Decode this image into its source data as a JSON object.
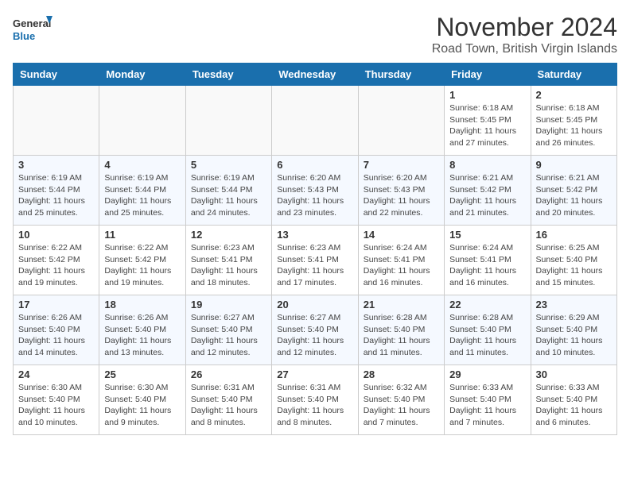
{
  "header": {
    "logo_line1": "General",
    "logo_line2": "Blue",
    "month": "November 2024",
    "location": "Road Town, British Virgin Islands"
  },
  "weekdays": [
    "Sunday",
    "Monday",
    "Tuesday",
    "Wednesday",
    "Thursday",
    "Friday",
    "Saturday"
  ],
  "weeks": [
    [
      {
        "day": "",
        "info": ""
      },
      {
        "day": "",
        "info": ""
      },
      {
        "day": "",
        "info": ""
      },
      {
        "day": "",
        "info": ""
      },
      {
        "day": "",
        "info": ""
      },
      {
        "day": "1",
        "info": "Sunrise: 6:18 AM\nSunset: 5:45 PM\nDaylight: 11 hours and 27 minutes."
      },
      {
        "day": "2",
        "info": "Sunrise: 6:18 AM\nSunset: 5:45 PM\nDaylight: 11 hours and 26 minutes."
      }
    ],
    [
      {
        "day": "3",
        "info": "Sunrise: 6:19 AM\nSunset: 5:44 PM\nDaylight: 11 hours and 25 minutes."
      },
      {
        "day": "4",
        "info": "Sunrise: 6:19 AM\nSunset: 5:44 PM\nDaylight: 11 hours and 25 minutes."
      },
      {
        "day": "5",
        "info": "Sunrise: 6:19 AM\nSunset: 5:44 PM\nDaylight: 11 hours and 24 minutes."
      },
      {
        "day": "6",
        "info": "Sunrise: 6:20 AM\nSunset: 5:43 PM\nDaylight: 11 hours and 23 minutes."
      },
      {
        "day": "7",
        "info": "Sunrise: 6:20 AM\nSunset: 5:43 PM\nDaylight: 11 hours and 22 minutes."
      },
      {
        "day": "8",
        "info": "Sunrise: 6:21 AM\nSunset: 5:42 PM\nDaylight: 11 hours and 21 minutes."
      },
      {
        "day": "9",
        "info": "Sunrise: 6:21 AM\nSunset: 5:42 PM\nDaylight: 11 hours and 20 minutes."
      }
    ],
    [
      {
        "day": "10",
        "info": "Sunrise: 6:22 AM\nSunset: 5:42 PM\nDaylight: 11 hours and 19 minutes."
      },
      {
        "day": "11",
        "info": "Sunrise: 6:22 AM\nSunset: 5:42 PM\nDaylight: 11 hours and 19 minutes."
      },
      {
        "day": "12",
        "info": "Sunrise: 6:23 AM\nSunset: 5:41 PM\nDaylight: 11 hours and 18 minutes."
      },
      {
        "day": "13",
        "info": "Sunrise: 6:23 AM\nSunset: 5:41 PM\nDaylight: 11 hours and 17 minutes."
      },
      {
        "day": "14",
        "info": "Sunrise: 6:24 AM\nSunset: 5:41 PM\nDaylight: 11 hours and 16 minutes."
      },
      {
        "day": "15",
        "info": "Sunrise: 6:24 AM\nSunset: 5:41 PM\nDaylight: 11 hours and 16 minutes."
      },
      {
        "day": "16",
        "info": "Sunrise: 6:25 AM\nSunset: 5:40 PM\nDaylight: 11 hours and 15 minutes."
      }
    ],
    [
      {
        "day": "17",
        "info": "Sunrise: 6:26 AM\nSunset: 5:40 PM\nDaylight: 11 hours and 14 minutes."
      },
      {
        "day": "18",
        "info": "Sunrise: 6:26 AM\nSunset: 5:40 PM\nDaylight: 11 hours and 13 minutes."
      },
      {
        "day": "19",
        "info": "Sunrise: 6:27 AM\nSunset: 5:40 PM\nDaylight: 11 hours and 12 minutes."
      },
      {
        "day": "20",
        "info": "Sunrise: 6:27 AM\nSunset: 5:40 PM\nDaylight: 11 hours and 12 minutes."
      },
      {
        "day": "21",
        "info": "Sunrise: 6:28 AM\nSunset: 5:40 PM\nDaylight: 11 hours and 11 minutes."
      },
      {
        "day": "22",
        "info": "Sunrise: 6:28 AM\nSunset: 5:40 PM\nDaylight: 11 hours and 11 minutes."
      },
      {
        "day": "23",
        "info": "Sunrise: 6:29 AM\nSunset: 5:40 PM\nDaylight: 11 hours and 10 minutes."
      }
    ],
    [
      {
        "day": "24",
        "info": "Sunrise: 6:30 AM\nSunset: 5:40 PM\nDaylight: 11 hours and 10 minutes."
      },
      {
        "day": "25",
        "info": "Sunrise: 6:30 AM\nSunset: 5:40 PM\nDaylight: 11 hours and 9 minutes."
      },
      {
        "day": "26",
        "info": "Sunrise: 6:31 AM\nSunset: 5:40 PM\nDaylight: 11 hours and 8 minutes."
      },
      {
        "day": "27",
        "info": "Sunrise: 6:31 AM\nSunset: 5:40 PM\nDaylight: 11 hours and 8 minutes."
      },
      {
        "day": "28",
        "info": "Sunrise: 6:32 AM\nSunset: 5:40 PM\nDaylight: 11 hours and 7 minutes."
      },
      {
        "day": "29",
        "info": "Sunrise: 6:33 AM\nSunset: 5:40 PM\nDaylight: 11 hours and 7 minutes."
      },
      {
        "day": "30",
        "info": "Sunrise: 6:33 AM\nSunset: 5:40 PM\nDaylight: 11 hours and 6 minutes."
      }
    ]
  ]
}
